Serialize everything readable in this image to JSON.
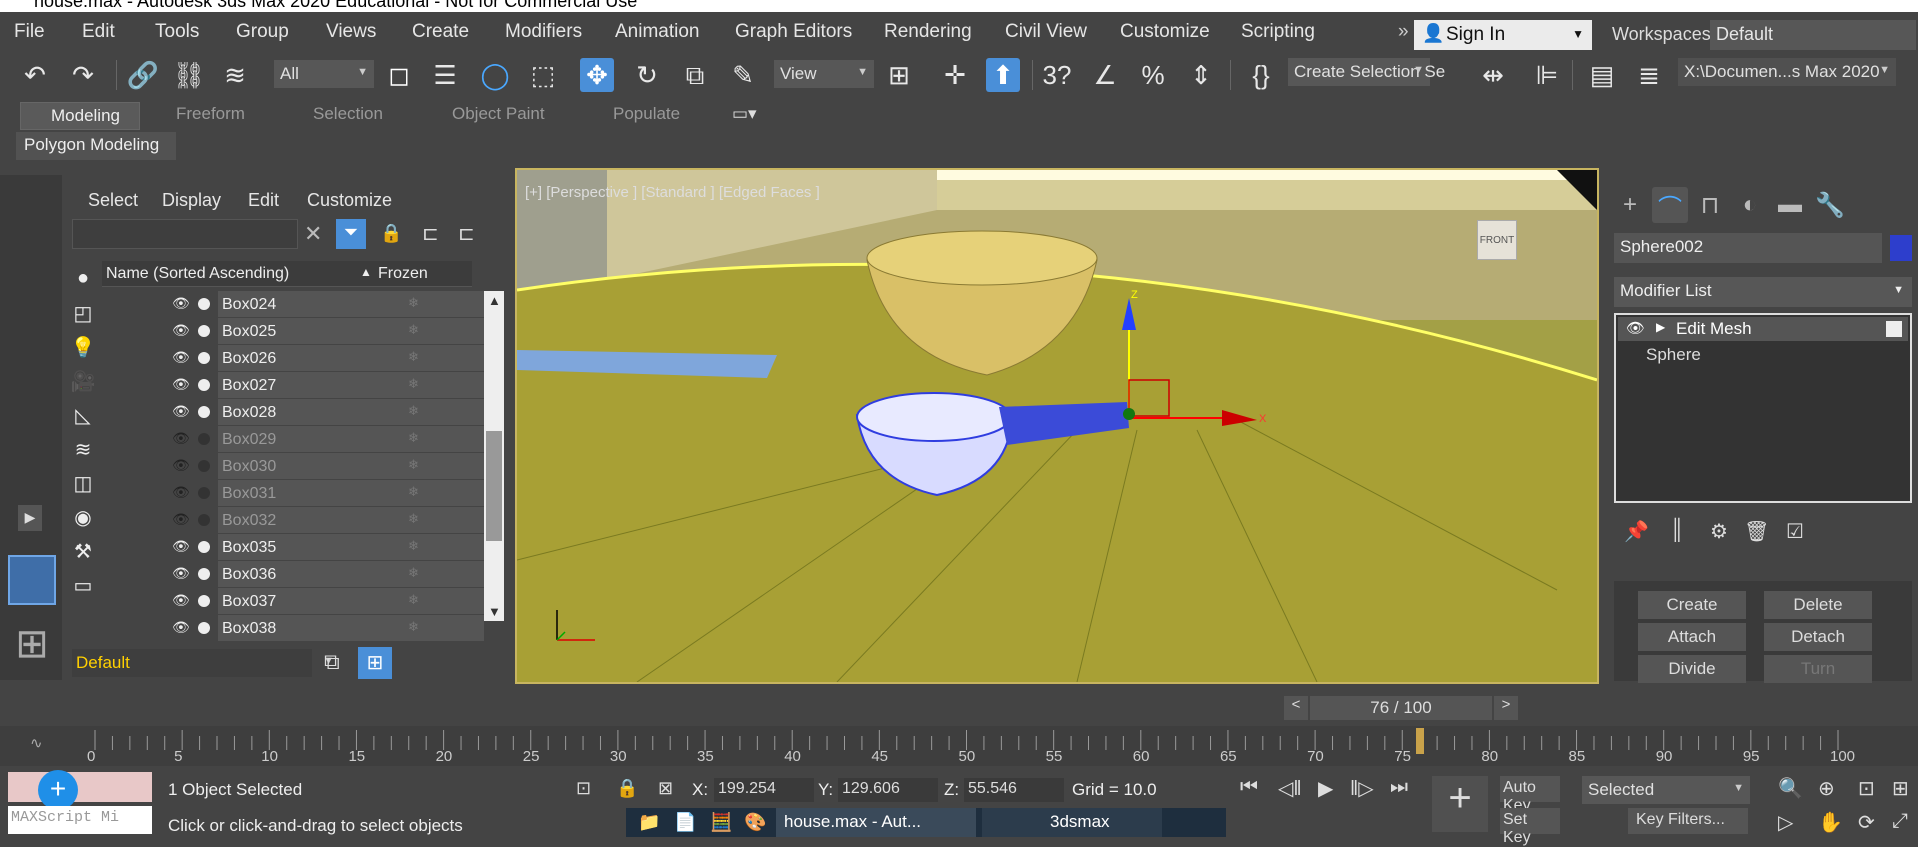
{
  "window": {
    "title": "house.max - Autodesk 3ds Max 2020 Educational - Not for Commercial Use"
  },
  "menu": [
    "File",
    "Edit",
    "Tools",
    "Group",
    "Views",
    "Create",
    "Modifiers",
    "Animation",
    "Graph Editors",
    "Rendering",
    "Civil View",
    "Customize",
    "Scripting"
  ],
  "account": {
    "sign_in": "Sign In",
    "workspaces_label": "Workspaces:",
    "workspace": "Default"
  },
  "toolbar": {
    "filter": "All",
    "view": "View",
    "selection_set": "Create Selection Se",
    "project_path": "X:\\Documen...s Max 2020"
  },
  "ribbon": {
    "tabs": [
      "Modeling",
      "Freeform",
      "Selection",
      "Object Paint",
      "Populate"
    ],
    "panel": "Polygon Modeling"
  },
  "scene_explorer": {
    "menus": [
      "Select",
      "Display",
      "Edit",
      "Customize"
    ],
    "columns": {
      "name": "Name (Sorted Ascending)",
      "frozen": "Frozen"
    },
    "rows": [
      {
        "name": "Box024",
        "visible": true
      },
      {
        "name": "Box025",
        "visible": true
      },
      {
        "name": "Box026",
        "visible": true
      },
      {
        "name": "Box027",
        "visible": true
      },
      {
        "name": "Box028",
        "visible": true
      },
      {
        "name": "Box029",
        "visible": false
      },
      {
        "name": "Box030",
        "visible": false
      },
      {
        "name": "Box031",
        "visible": false
      },
      {
        "name": "Box032",
        "visible": false
      },
      {
        "name": "Box035",
        "visible": true
      },
      {
        "name": "Box036",
        "visible": true
      },
      {
        "name": "Box037",
        "visible": true
      },
      {
        "name": "Box038",
        "visible": true
      }
    ],
    "layer": "Default"
  },
  "viewport": {
    "label": "[+] [Perspective ] [Standard ] [Edged Faces ]",
    "viewcube": "FRONT"
  },
  "command_panel": {
    "object_name": "Sphere002",
    "object_color": "#2d3ecc",
    "modifier_list": "Modifier List",
    "stack": [
      "Edit Mesh",
      "Sphere"
    ],
    "buttons": [
      "Create",
      "Delete",
      "Attach",
      "Detach",
      "Divide",
      "Turn"
    ]
  },
  "timeline": {
    "frame": "76 / 100",
    "ticks": [
      "0",
      "5",
      "10",
      "15",
      "20",
      "25",
      "30",
      "35",
      "40",
      "45",
      "50",
      "55",
      "60",
      "65",
      "70",
      "75",
      "80",
      "85",
      "90",
      "95",
      "100"
    ],
    "current": 76
  },
  "status": {
    "selection": "1 Object Selected",
    "prompt": "Click or click-and-drag to select objects",
    "maxscript": "MAXScript Mi",
    "x_label": "X:",
    "x": "199.254",
    "y_label": "Y:",
    "y": "129.606",
    "z_label": "Z:",
    "z": "55.546",
    "grid": "Grid = 10.0",
    "auto_key": "Auto Key",
    "set_key": "Set Key",
    "key_mode": "Selected",
    "key_filters": "Key Filters..."
  },
  "taskbar": {
    "items": [
      "house.max - Aut...",
      "3dsmax"
    ]
  }
}
